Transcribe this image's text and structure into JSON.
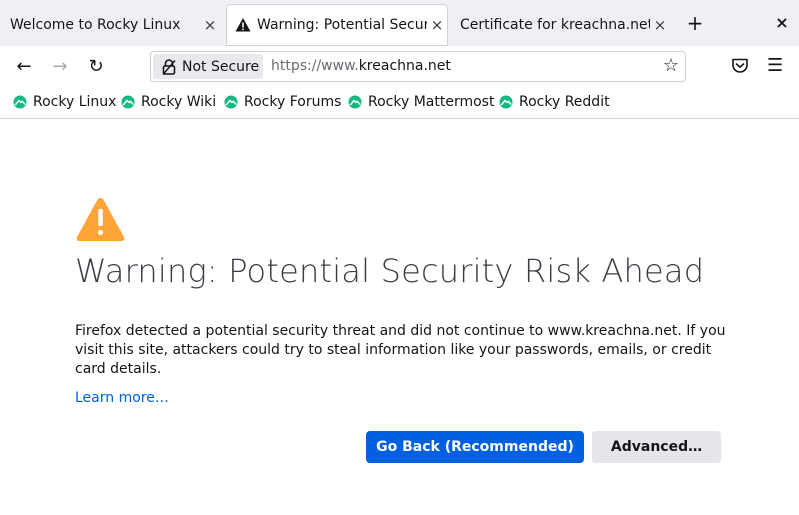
{
  "tabs": [
    {
      "label": "Welcome to Rocky Linux",
      "close": "×"
    },
    {
      "label": "Warning: Potential Security Risk Ahead",
      "close": "×"
    },
    {
      "label": "Certificate for kreachna.net",
      "close": "×"
    }
  ],
  "tabstrip": {
    "new_tab": "+",
    "window_close": "×"
  },
  "navbar": {
    "back": "←",
    "forward": "→",
    "reload": "↻",
    "security_label": "Not Secure",
    "url_scheme": "https://www.",
    "url_host": "kreachna.net",
    "bookmark_star": "☆",
    "menu": "☰"
  },
  "bookmarks": [
    {
      "label": "Rocky Linux"
    },
    {
      "label": "Rocky Wiki"
    },
    {
      "label": "Rocky Forums"
    },
    {
      "label": "Rocky Mattermost"
    },
    {
      "label": "Rocky Reddit"
    }
  ],
  "page": {
    "title": "Warning: Potential Security Risk Ahead",
    "description": "Firefox detected a potential security threat and did not continue to www.kreachna.net. If you visit this site, attackers could try to steal information like your passwords, emails, or credit card details.",
    "learn_more": "Learn more…",
    "go_back": "Go Back (Recommended)",
    "advanced": "Advanced…"
  },
  "colors": {
    "primary_button": "#0061e0",
    "warning": "#ffa436",
    "rocky_green": "#10b981"
  },
  "icons": {
    "warning": "warning-triangle-icon",
    "lock": "lock-insecure-icon",
    "pocket": "pocket-icon",
    "bookmark_favicon": "rocky-linux-icon"
  }
}
